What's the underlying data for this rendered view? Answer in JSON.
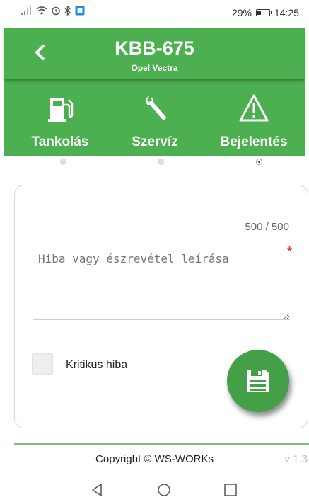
{
  "status_bar": {
    "battery_percent": "29%",
    "time": "14:25",
    "battery_level": 0.29,
    "icons": [
      "signal-icon",
      "wifi-icon",
      "alarm-icon",
      "bluetooth-icon",
      "app-notification-icon"
    ]
  },
  "header": {
    "plate": "KBB-675",
    "model": "Opel Vectra",
    "back_icon": "chevron-left-icon"
  },
  "tabs": [
    {
      "label": "Tankolás",
      "icon": "fuel-pump-icon"
    },
    {
      "label": "Szervíz",
      "icon": "wrench-icon"
    },
    {
      "label": "Bejelentés",
      "icon": "warning-triangle-icon"
    }
  ],
  "pager": {
    "active_index": 2,
    "count": 3
  },
  "form": {
    "char_counter": "500 / 500",
    "description_placeholder": "Hiba vagy észrevétel leírása",
    "required_mark": "*",
    "critical_label": "Kritikus hiba",
    "critical_checked": false,
    "save_icon": "save-icon"
  },
  "footer": {
    "copyright": "Copyright © WS-WORKs",
    "version": "v 1.3"
  },
  "nav_bar": {
    "icons": [
      "back-triangle-icon",
      "home-circle-icon",
      "recents-square-icon"
    ]
  },
  "colors": {
    "primary_green": "#4caf50",
    "fab_green": "#43a047",
    "required_red": "#e53935"
  }
}
